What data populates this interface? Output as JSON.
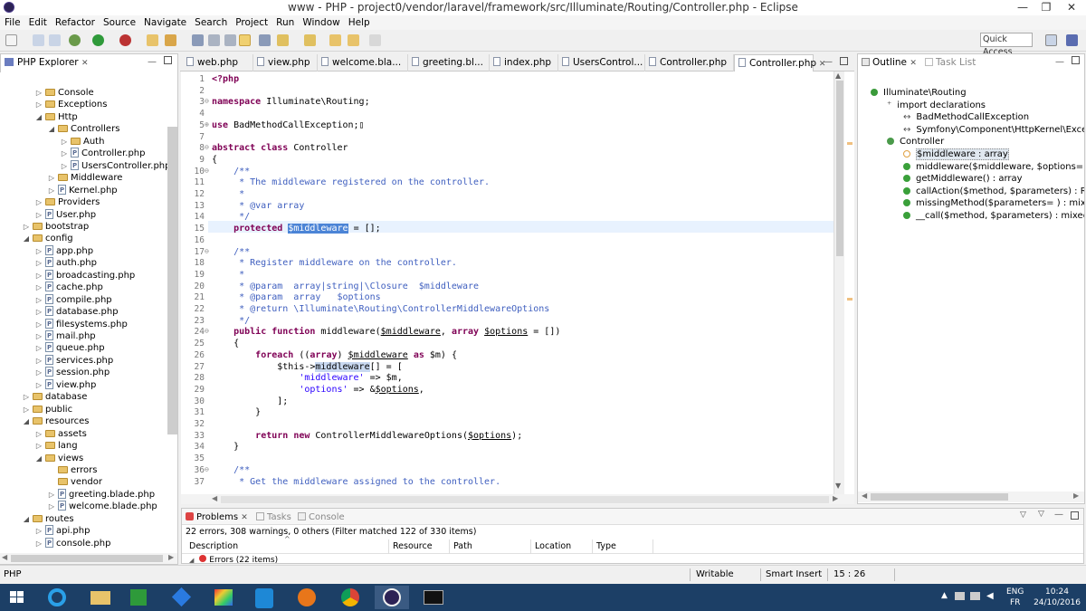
{
  "window": {
    "title": "www - PHP - project0/vendor/laravel/framework/src/Illuminate/Routing/Controller.php - Eclipse",
    "min": "—",
    "max": "❐",
    "close": "✕"
  },
  "menu": [
    "File",
    "Edit",
    "Refactor",
    "Source",
    "Navigate",
    "Search",
    "Project",
    "Run",
    "Window",
    "Help"
  ],
  "quick_access": "Quick Access",
  "explorer": {
    "title": "PHP Explorer",
    "items": [
      {
        "label": "Console",
        "level": 3,
        "type": "folder",
        "tw": "▷"
      },
      {
        "label": "Exceptions",
        "level": 3,
        "type": "folder",
        "tw": "▷"
      },
      {
        "label": "Http",
        "level": 3,
        "type": "folder",
        "tw": "◢"
      },
      {
        "label": "Controllers",
        "level": 4,
        "type": "folder",
        "tw": "◢"
      },
      {
        "label": "Auth",
        "level": 5,
        "type": "folder",
        "tw": "▷"
      },
      {
        "label": "Controller.php",
        "level": 5,
        "type": "file",
        "tw": "▷"
      },
      {
        "label": "UsersController.php",
        "level": 5,
        "type": "file",
        "tw": "▷"
      },
      {
        "label": "Middleware",
        "level": 4,
        "type": "folder",
        "tw": "▷"
      },
      {
        "label": "Kernel.php",
        "level": 4,
        "type": "file",
        "tw": "▷"
      },
      {
        "label": "Providers",
        "level": 3,
        "type": "folder",
        "tw": "▷"
      },
      {
        "label": "User.php",
        "level": 3,
        "type": "file",
        "tw": "▷"
      },
      {
        "label": "bootstrap",
        "level": 2,
        "type": "folder",
        "tw": "▷"
      },
      {
        "label": "config",
        "level": 2,
        "type": "folder",
        "tw": "◢"
      },
      {
        "label": "app.php",
        "level": 3,
        "type": "file",
        "tw": "▷"
      },
      {
        "label": "auth.php",
        "level": 3,
        "type": "file",
        "tw": "▷"
      },
      {
        "label": "broadcasting.php",
        "level": 3,
        "type": "file",
        "tw": "▷"
      },
      {
        "label": "cache.php",
        "level": 3,
        "type": "file",
        "tw": "▷"
      },
      {
        "label": "compile.php",
        "level": 3,
        "type": "file",
        "tw": "▷"
      },
      {
        "label": "database.php",
        "level": 3,
        "type": "file",
        "tw": "▷"
      },
      {
        "label": "filesystems.php",
        "level": 3,
        "type": "file",
        "tw": "▷"
      },
      {
        "label": "mail.php",
        "level": 3,
        "type": "file",
        "tw": "▷"
      },
      {
        "label": "queue.php",
        "level": 3,
        "type": "file",
        "tw": "▷"
      },
      {
        "label": "services.php",
        "level": 3,
        "type": "file",
        "tw": "▷"
      },
      {
        "label": "session.php",
        "level": 3,
        "type": "file",
        "tw": "▷"
      },
      {
        "label": "view.php",
        "level": 3,
        "type": "file",
        "tw": "▷"
      },
      {
        "label": "database",
        "level": 2,
        "type": "folder",
        "tw": "▷"
      },
      {
        "label": "public",
        "level": 2,
        "type": "folder",
        "tw": "▷"
      },
      {
        "label": "resources",
        "level": 2,
        "type": "folder",
        "tw": "◢"
      },
      {
        "label": "assets",
        "level": 3,
        "type": "folder",
        "tw": "▷"
      },
      {
        "label": "lang",
        "level": 3,
        "type": "folder",
        "tw": "▷"
      },
      {
        "label": "views",
        "level": 3,
        "type": "folder",
        "tw": "◢"
      },
      {
        "label": "errors",
        "level": 4,
        "type": "folder",
        "tw": ""
      },
      {
        "label": "vendor",
        "level": 4,
        "type": "folder",
        "tw": ""
      },
      {
        "label": "greeting.blade.php",
        "level": 4,
        "type": "file",
        "tw": "▷"
      },
      {
        "label": "welcome.blade.php",
        "level": 4,
        "type": "file",
        "tw": "▷"
      },
      {
        "label": "routes",
        "level": 2,
        "type": "folder",
        "tw": "◢"
      },
      {
        "label": "api.php",
        "level": 3,
        "type": "file",
        "tw": "▷"
      },
      {
        "label": "console.php",
        "level": 3,
        "type": "file",
        "tw": "▷"
      }
    ]
  },
  "editor_tabs": [
    "web.php",
    "view.php",
    "welcome.bla...",
    "greeting.bl...",
    "index.php",
    "UsersControl...",
    "Controller.php",
    "Controller.php"
  ],
  "editor_tab_close": "✕",
  "code_lines": [
    {
      "n": "1",
      "html": "<span class='kw'>&lt;?php</span>"
    },
    {
      "n": "2",
      "html": ""
    },
    {
      "n": "3",
      "fold": "⊖",
      "html": "<span class='kw'>namespace</span> Illuminate\\Routing;"
    },
    {
      "n": "4",
      "html": ""
    },
    {
      "n": "5",
      "fold": "⊕",
      "html": "<span class='kw'>use</span> BadMethodCallException;▯"
    },
    {
      "n": "7",
      "html": ""
    },
    {
      "n": "8",
      "fold": "⊖",
      "html": "<span class='kw'>abstract class</span> Controller"
    },
    {
      "n": "9",
      "html": "{"
    },
    {
      "n": "10",
      "fold": "⊖",
      "html": "    <span class='cm'>/**</span>"
    },
    {
      "n": "11",
      "html": "<span class='cm'>     * The middleware registered on the controller.</span>"
    },
    {
      "n": "12",
      "html": "<span class='cm'>     *</span>"
    },
    {
      "n": "13",
      "html": "<span class='cm'>     * @var array</span>"
    },
    {
      "n": "14",
      "html": "<span class='cm'>     */</span>"
    },
    {
      "n": "15",
      "html": "    <span class='kw'>protected</span> <span class='sel'>$middleware</span> = [];",
      "current": true
    },
    {
      "n": "16",
      "html": ""
    },
    {
      "n": "17",
      "fold": "⊖",
      "html": "    <span class='cm'>/**</span>"
    },
    {
      "n": "18",
      "html": "<span class='cm'>     * Register middleware on the controller.</span>"
    },
    {
      "n": "19",
      "html": "<span class='cm'>     *</span>"
    },
    {
      "n": "20",
      "html": "<span class='cm'>     * @param  array|string|\\Closure  $middleware</span>"
    },
    {
      "n": "21",
      "html": "<span class='cm'>     * @param  array   $options</span>"
    },
    {
      "n": "22",
      "html": "<span class='cm'>     * @return \\Illuminate\\Routing\\ControllerMiddlewareOptions</span>"
    },
    {
      "n": "23",
      "html": "<span class='cm'>     */</span>"
    },
    {
      "n": "24",
      "fold": "⊖",
      "html": "    <span class='kw'>public function</span> middleware(<span class='var'>$middleware</span>, <span class='kw'>array</span> <span class='var'>$options</span> = [])"
    },
    {
      "n": "25",
      "html": "    {"
    },
    {
      "n": "26",
      "html": "        <span class='kw'>foreach</span> ((<span class='kw'>array</span>) <span class='var'>$middleware</span> <span class='kw'>as</span> $m) {"
    },
    {
      "n": "27",
      "html": "            $this-&gt;<span class='hl'>middleware</span>[] = ["
    },
    {
      "n": "28",
      "html": "                <span class='st'>'middleware'</span> =&gt; $m,"
    },
    {
      "n": "29",
      "html": "                <span class='st'>'options'</span> =&gt; &amp;<span class='var'>$options</span>,"
    },
    {
      "n": "30",
      "html": "            ];"
    },
    {
      "n": "31",
      "html": "        }"
    },
    {
      "n": "32",
      "html": ""
    },
    {
      "n": "33",
      "html": "        <span class='kw'>return new</span> ControllerMiddlewareOptions(<span class='var'>$options</span>);"
    },
    {
      "n": "34",
      "html": "    }"
    },
    {
      "n": "35",
      "html": ""
    },
    {
      "n": "36",
      "fold": "⊖",
      "html": "    <span class='cm'>/**</span>"
    },
    {
      "n": "37",
      "html": "<span class='cm'>     * Get the middleware assigned to the controller.</span>"
    }
  ],
  "outline": {
    "title": "Outline",
    "tasklist": "Task List",
    "items": [
      {
        "label": "Illuminate\\Routing",
        "level": 0,
        "kind": "ns"
      },
      {
        "label": "import declarations",
        "level": 1,
        "kind": "imp"
      },
      {
        "label": "BadMethodCallException",
        "level": 2,
        "kind": "use"
      },
      {
        "label": "Symfony\\Component\\HttpKernel\\Excepti",
        "level": 2,
        "kind": "use"
      },
      {
        "label": "Controller",
        "level": 1,
        "kind": "class"
      },
      {
        "label": "$middleware : array",
        "level": 2,
        "kind": "field"
      },
      {
        "label": "middleware($middleware, $options= ) : Co",
        "level": 2,
        "kind": "method"
      },
      {
        "label": "getMiddleware() : array",
        "level": 2,
        "kind": "method"
      },
      {
        "label": "callAction($method, $parameters) : Respo",
        "level": 2,
        "kind": "method"
      },
      {
        "label": "missingMethod($parameters= ) : mixed",
        "level": 2,
        "kind": "method"
      },
      {
        "label": "__call($method, $parameters) : mixed",
        "level": 2,
        "kind": "method"
      }
    ]
  },
  "problems": {
    "tabs": [
      "Problems",
      "Tasks",
      "Console"
    ],
    "summary": "22 errors, 308 warnings, 0 others (Filter matched 122 of 330 items)",
    "columns": [
      "Description",
      "Resource",
      "Path",
      "Location",
      "Type"
    ],
    "row": "Errors (22 items)"
  },
  "status": {
    "perspective": "PHP",
    "mode": "Writable",
    "insert": "Smart Insert",
    "pos": "15 : 26"
  },
  "taskbar": {
    "lang1": "ENG",
    "lang2": "FR",
    "time": "10:24",
    "date": "24/10/2016"
  },
  "colors": {
    "accent": "#4b84d6",
    "taskbar": "#1c3f66",
    "keyword": "#7f0055",
    "comment": "#3f5fbf",
    "string": "#2a00ff"
  }
}
